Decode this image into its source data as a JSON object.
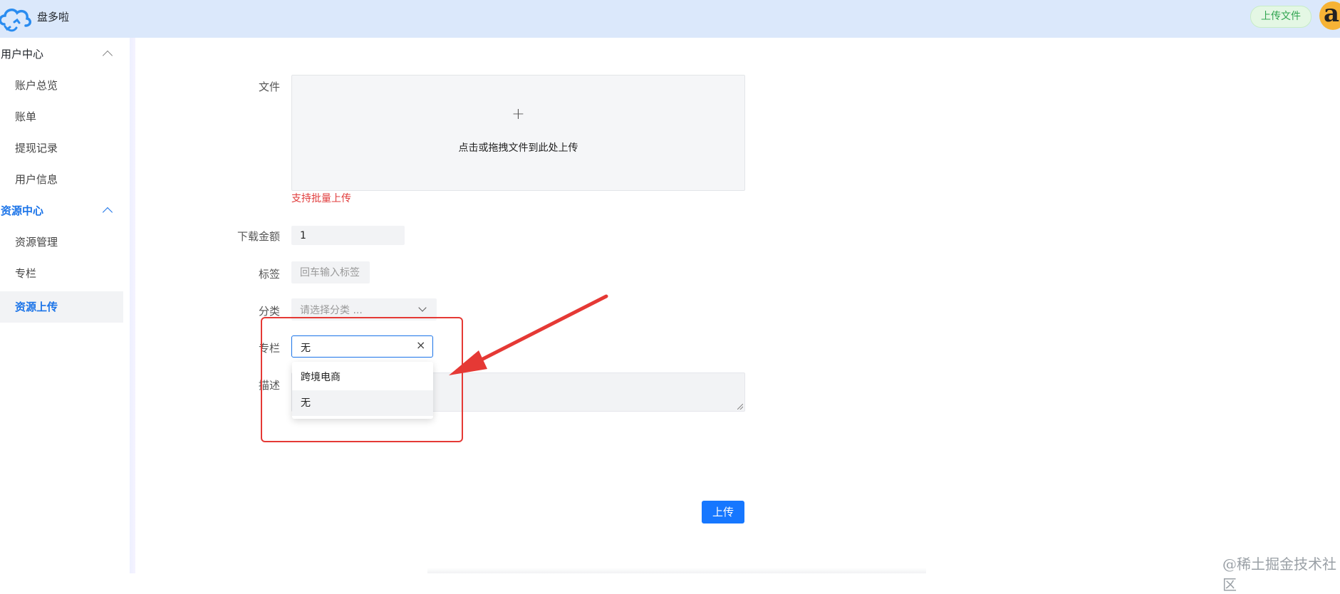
{
  "header": {
    "brand": "盘多啦",
    "upload_file_label": "上传文件"
  },
  "sidebar": {
    "groups": [
      {
        "label": "用户中心",
        "expanded": true,
        "items": [
          "账户总览",
          "账单",
          "提现记录",
          "用户信息"
        ]
      },
      {
        "label": "资源中心",
        "expanded": true,
        "active": true,
        "items": [
          "资源管理",
          "专栏",
          "资源上传"
        ]
      }
    ],
    "active_item": "资源上传"
  },
  "form": {
    "file_label": "文件",
    "dropzone_plus": "+",
    "dropzone_text": "点击或拖拽文件到此处上传",
    "batch_hint": "支持批量上传",
    "amount_label": "下载金额",
    "amount_value": "1",
    "tag_label": "标签",
    "tag_placeholder": "回车输入标签",
    "category_label": "分类",
    "category_placeholder": "请选择分类 ...",
    "column_label": "专栏",
    "column_value": "无",
    "clear_glyph": "×",
    "desc_label": "描述",
    "column_options": [
      "跨境电商",
      "无"
    ],
    "column_selected": "无",
    "submit_label": "上传"
  },
  "annotation": {
    "box_color": "#e53935",
    "arrow_color": "#e53935"
  },
  "watermark": "@稀土掘金技术社区",
  "colors": {
    "accent": "#1a73e8",
    "primary_button": "#1677ff",
    "hint_red": "#e03b3b",
    "header_bg": "#dbe8fb",
    "upload_badge_green": "#2fa44f"
  }
}
